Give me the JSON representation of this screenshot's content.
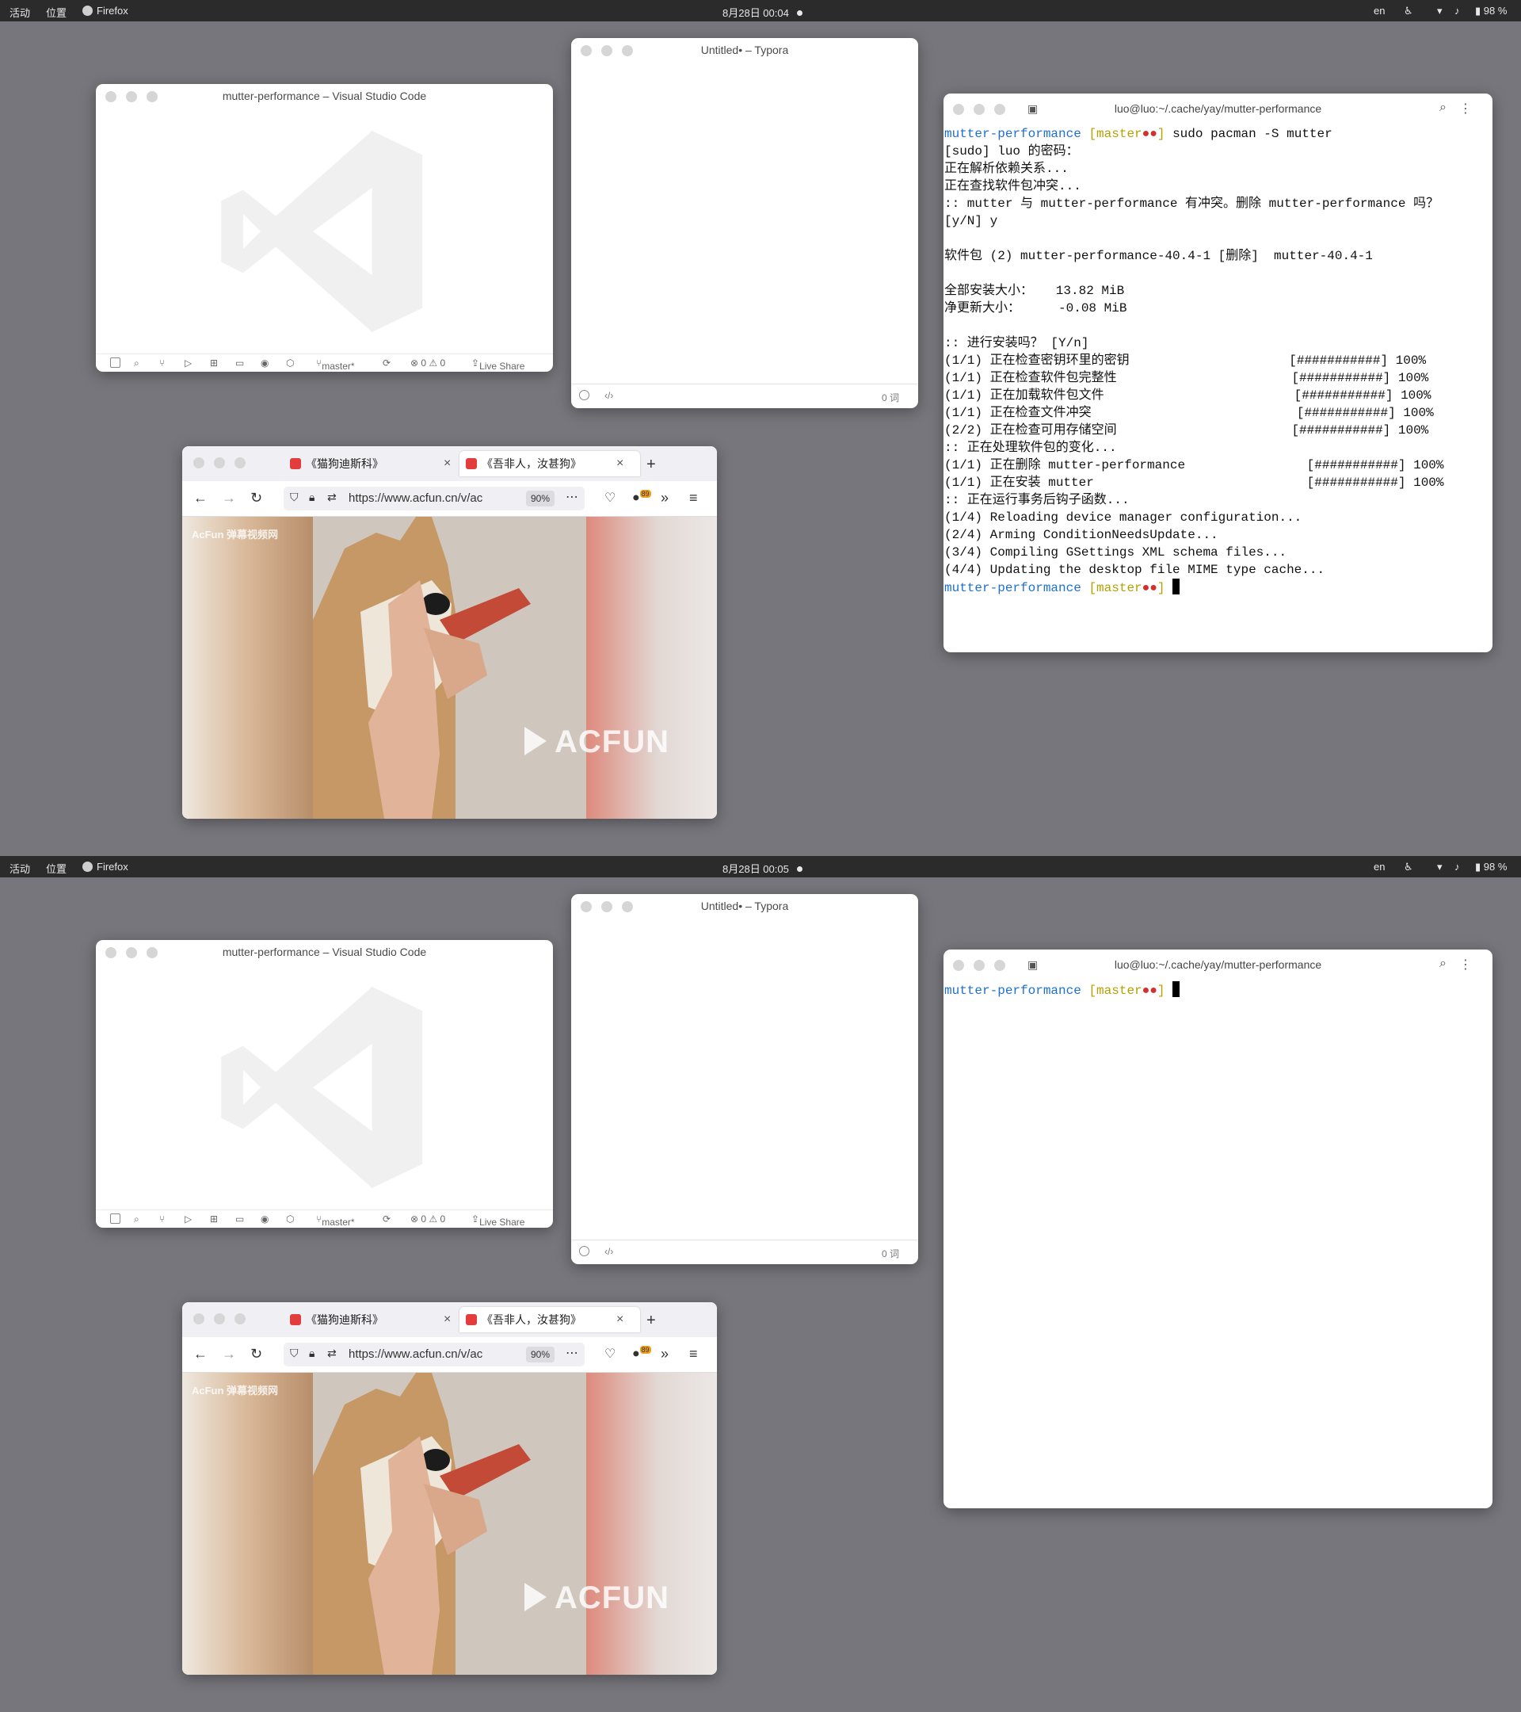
{
  "colors": {
    "desktop": "#76767c",
    "topbar": "#2b2b2b",
    "prompt_dir": "#1d6fd0",
    "prompt_branch": "#b5a000",
    "prompt_dirty": "#d0312d"
  },
  "topbar": {
    "activities": "活动",
    "places": "位置",
    "app": "Firefox",
    "lang": "en",
    "battery": "98 %"
  },
  "screens": [
    {
      "clock": "8月28日 00:04",
      "terminal_lines": [
        {
          "type": "prompt",
          "cmd": " sudo pacman -S mutter"
        },
        {
          "text": "[sudo] luo 的密码："
        },
        {
          "text": "正在解析依赖关系..."
        },
        {
          "text": "正在查找软件包冲突..."
        },
        {
          "text": ":: mutter 与 mutter-performance 有冲突。删除 mutter-performance 吗？"
        },
        {
          "text": "[y/N] y"
        },
        {
          "text": ""
        },
        {
          "text": "软件包 (2) mutter-performance-40.4-1 [删除]  mutter-40.4-1"
        },
        {
          "text": ""
        },
        {
          "text": "全部安装大小：   13.82 MiB"
        },
        {
          "text": "净更新大小：     -0.08 MiB"
        },
        {
          "text": ""
        },
        {
          "text": ":: 进行安装吗？ [Y/n]"
        },
        {
          "text": "(1/1) 正在检查密钥环里的密钥                     [###########] 100%"
        },
        {
          "text": "(1/1) 正在检查软件包完整性                       [###########] 100%"
        },
        {
          "text": "(1/1) 正在加载软件包文件                         [###########] 100%"
        },
        {
          "text": "(1/1) 正在检查文件冲突                           [###########] 100%"
        },
        {
          "text": "(2/2) 正在检查可用存储空间                       [###########] 100%"
        },
        {
          "text": ":: 正在处理软件包的变化..."
        },
        {
          "text": "(1/1) 正在删除 mutter-performance                [###########] 100%"
        },
        {
          "text": "(1/1) 正在安装 mutter                            [###########] 100%"
        },
        {
          "text": ":: 正在运行事务后钩子函数..."
        },
        {
          "text": "(1/4) Reloading device manager configuration..."
        },
        {
          "text": "(2/4) Arming ConditionNeedsUpdate..."
        },
        {
          "text": "(3/4) Compiling GSettings XML schema files..."
        },
        {
          "text": "(4/4) Updating the desktop file MIME type cache..."
        },
        {
          "type": "prompt",
          "cmd": " ",
          "cursor": true
        }
      ]
    },
    {
      "clock": "8月28日 00:05",
      "terminal_lines": [
        {
          "type": "prompt",
          "cmd": " ",
          "cursor": true
        }
      ]
    }
  ],
  "vscode": {
    "title": "mutter-performance – Visual Studio Code",
    "branch": "master*",
    "problems": "⊗ 0 ⚠ 0",
    "live_share": "Live Share"
  },
  "typora": {
    "title": "Untitled• – Typora",
    "word_count": "0 词"
  },
  "terminal": {
    "title": "luo@luo:~/.cache/yay/mutter-performance",
    "prompt_dir": "mutter-performance",
    "prompt_branch_open": "[master",
    "prompt_dots": "●●",
    "prompt_branch_close": "]"
  },
  "firefox": {
    "tab1": "《猫狗迪斯科》",
    "tab2": "《吾非人，汝甚狗》",
    "url": "https://www.acfun.cn/v/ac",
    "zoom": "90%",
    "ext_badge": "89",
    "watermark_small": "AcFun 弹幕视频网",
    "watermark_big": "ACFUN"
  }
}
